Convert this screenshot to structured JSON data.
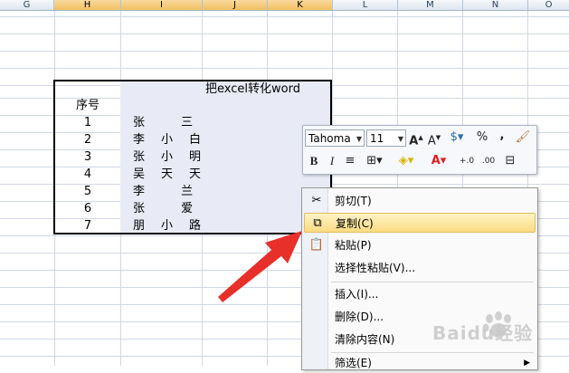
{
  "columns": [
    "G",
    "H",
    "I",
    "J",
    "K",
    "L",
    "M",
    "N",
    "O"
  ],
  "table": {
    "title": "把excel转化word",
    "header": "序号",
    "rows": [
      {
        "n": "1",
        "name": "张 三"
      },
      {
        "n": "2",
        "name": "李小白"
      },
      {
        "n": "3",
        "name": "张小明"
      },
      {
        "n": "4",
        "name": "吴天天"
      },
      {
        "n": "5",
        "name": "李 兰"
      },
      {
        "n": "6",
        "name": "张 爱"
      },
      {
        "n": "7",
        "name": "朋小路"
      }
    ]
  },
  "mini_toolbar": {
    "font": "Tahoma",
    "size": "11",
    "percent": "%",
    "comma": ","
  },
  "context_menu": {
    "cut": "剪切(T)",
    "copy": "复制(C)",
    "paste": "粘贴(P)",
    "paste_special": "选择性粘贴(V)...",
    "insert": "插入(I)...",
    "delete": "删除(D)...",
    "clear": "清除内容(N)",
    "filter": "筛选(E)"
  },
  "watermark": "Baidu经验",
  "colors": {
    "selection": "#e8ebf5",
    "highlight": "#fbdb82",
    "arrow": "#e8302b"
  }
}
